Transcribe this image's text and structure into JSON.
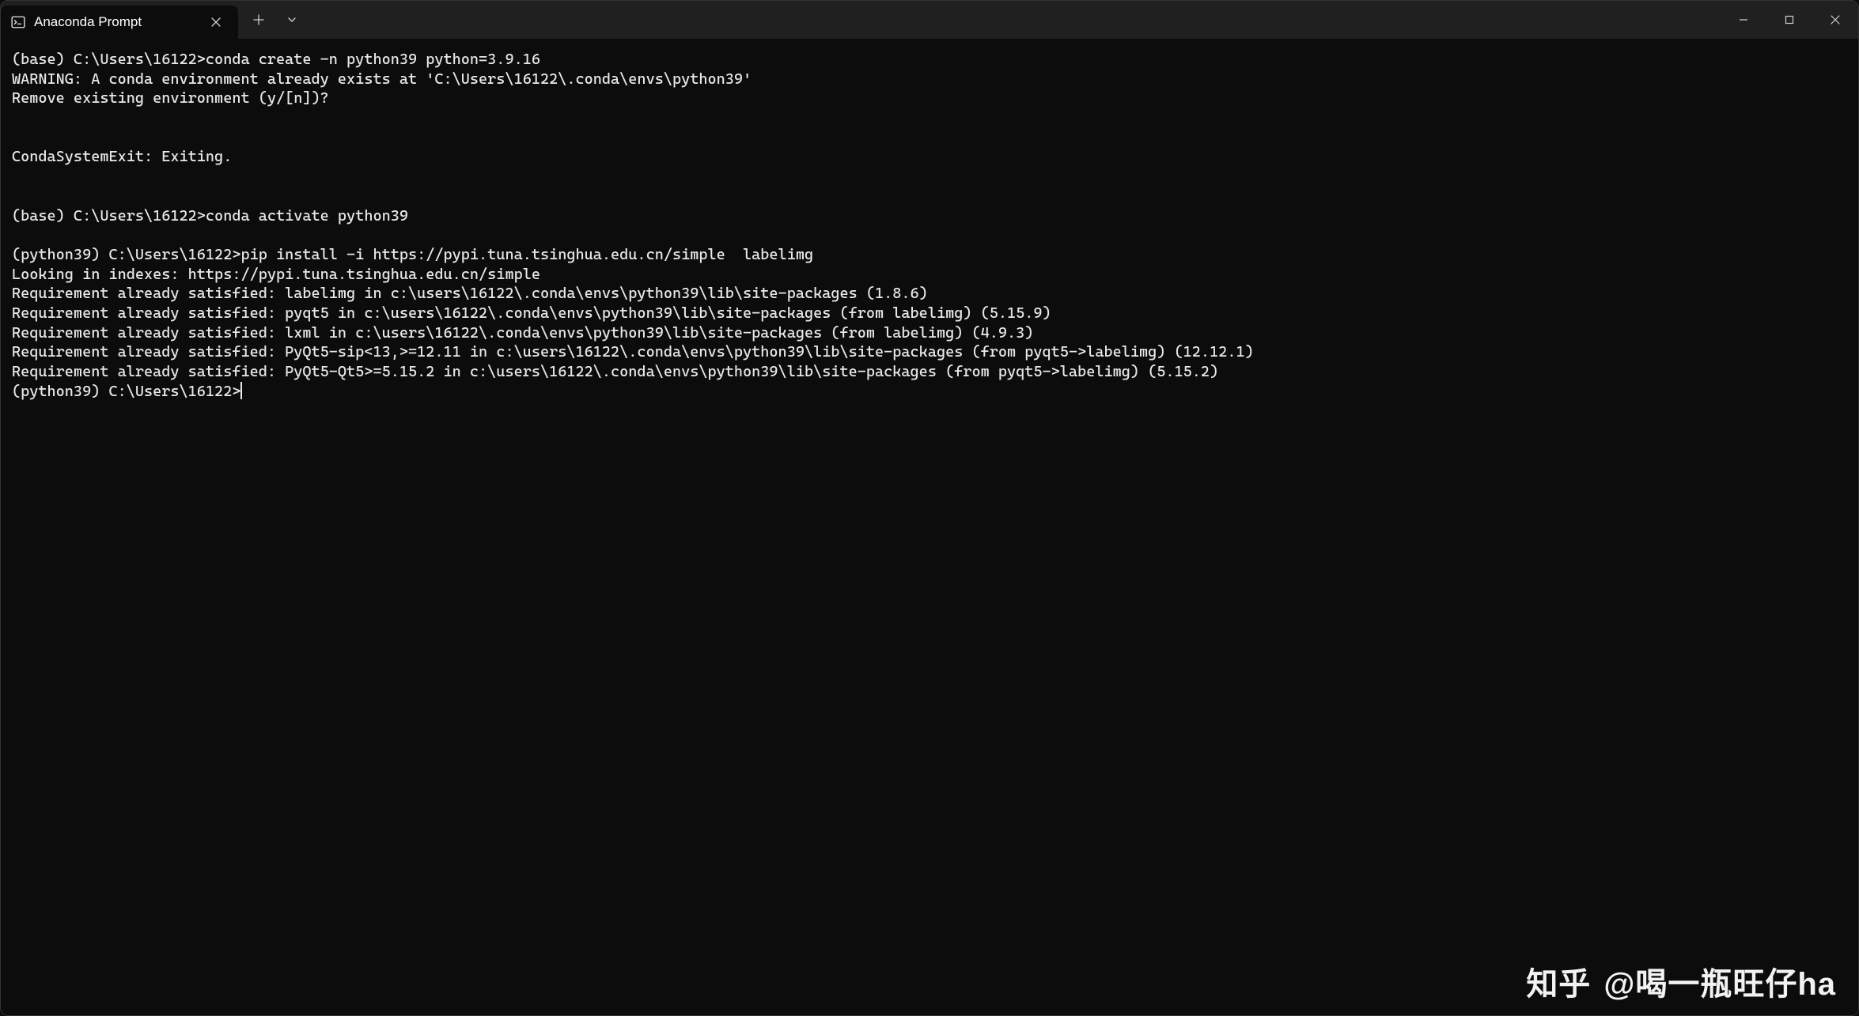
{
  "titlebar": {
    "tab_title": "Anaconda Prompt"
  },
  "terminal": {
    "block1": "(base) C:\\Users\\16122>conda create -n python39 python=3.9.16\nWARNING: A conda environment already exists at 'C:\\Users\\16122\\.conda\\envs\\python39'\nRemove existing environment (y/[n])?\n\n\nCondaSystemExit: Exiting.\n\n\n(base) C:\\Users\\16122>conda activate python39\n\n(python39) C:\\Users\\16122>pip install -i https://pypi.tuna.tsinghua.edu.cn/simple  labelimg\nLooking in indexes: https://pypi.tuna.tsinghua.edu.cn/simple\nRequirement already satisfied: labelimg in c:\\users\\16122\\.conda\\envs\\python39\\lib\\site-packages (1.8.6)\nRequirement already satisfied: pyqt5 in c:\\users\\16122\\.conda\\envs\\python39\\lib\\site-packages (from labelimg) (5.15.9)\nRequirement already satisfied: lxml in c:\\users\\16122\\.conda\\envs\\python39\\lib\\site-packages (from labelimg) (4.9.3)\nRequirement already satisfied: PyQt5-sip<13,>=12.11 in c:\\users\\16122\\.conda\\envs\\python39\\lib\\site-packages (from pyqt5->labelimg) (12.12.1)\nRequirement already satisfied: PyQt5-Qt5>=5.15.2 in c:\\users\\16122\\.conda\\envs\\python39\\lib\\site-packages (from pyqt5->labelimg) (5.15.2)\n",
    "current_prompt": "(python39) C:\\Users\\16122>"
  },
  "watermark": {
    "logo": "知乎",
    "text": "@喝一瓶旺仔ha"
  }
}
